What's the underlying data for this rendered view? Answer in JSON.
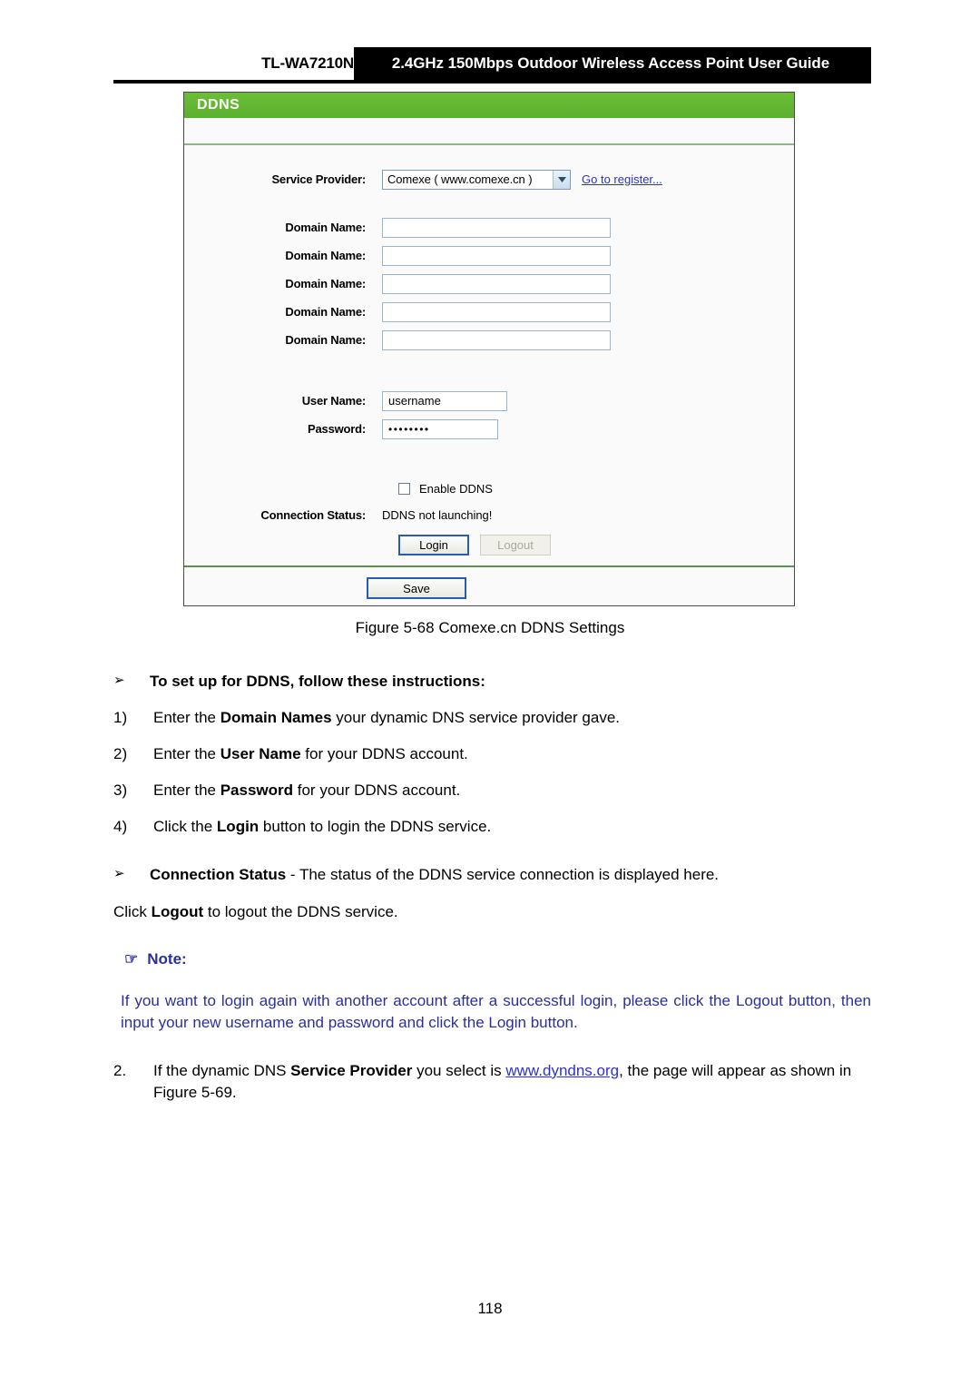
{
  "header": {
    "model": "TL-WA7210N",
    "title": "2.4GHz 150Mbps Outdoor Wireless Access Point User Guide"
  },
  "panel": {
    "title": "DDNS",
    "service_provider": {
      "label": "Service Provider:",
      "selected": "Comexe ( www.comexe.cn )",
      "register_link": "Go to register..."
    },
    "domain_rows": [
      {
        "label": "Domain Name:",
        "value": ""
      },
      {
        "label": "Domain Name:",
        "value": ""
      },
      {
        "label": "Domain Name:",
        "value": ""
      },
      {
        "label": "Domain Name:",
        "value": ""
      },
      {
        "label": "Domain Name:",
        "value": ""
      }
    ],
    "user_name": {
      "label": "User Name:",
      "value": "username"
    },
    "password": {
      "label": "Password:",
      "value": "••••••••"
    },
    "enable_ddns": {
      "label": "Enable DDNS",
      "checked": false
    },
    "connection_status": {
      "label": "Connection Status:",
      "value": "DDNS not launching!"
    },
    "login_button": "Login",
    "logout_button": "Logout",
    "save_button": "Save"
  },
  "caption": "Figure 5-68 Comexe.cn DDNS Settings",
  "instructions": {
    "heading_glyph": "➢",
    "heading": "To set up for DDNS, follow these instructions:",
    "steps": [
      {
        "marker": "1)",
        "pre": "Enter the ",
        "bold": "Domain Names",
        "post": " your dynamic DNS service provider gave."
      },
      {
        "marker": "2)",
        "pre": "Enter the ",
        "bold": "User Name",
        "post": " for your DDNS account."
      },
      {
        "marker": "3)",
        "pre": "Enter the ",
        "bold": "Password",
        "post": " for your DDNS account."
      },
      {
        "marker": "4)",
        "pre": "Click the ",
        "bold": "Login",
        "post": " button to login the DDNS service."
      }
    ]
  },
  "connection_bullet": {
    "glyph": "➢",
    "bold": "Connection Status",
    "rest": " - The status of the DDNS service connection is displayed here."
  },
  "logout_line": {
    "pre": "Click ",
    "bold": "Logout",
    "post": " to logout the DDNS service."
  },
  "note": {
    "glyph": "☞",
    "title": "Note:",
    "body": "If you want to login again with another account after a successful login, please click the Logout button, then input your new username and password and click the Login button."
  },
  "item2": {
    "marker": "2.",
    "pre": "If the dynamic DNS ",
    "bold": "Service Provider",
    "mid": " you select is ",
    "link": "www.dyndns.org",
    "post": ", the page will appear as shown in Figure 5-69."
  },
  "page_number": "118",
  "colors": {
    "panel_green": "#5cb030",
    "link_blue": "#2b33c9",
    "note_blue": "#2b2f9e"
  }
}
